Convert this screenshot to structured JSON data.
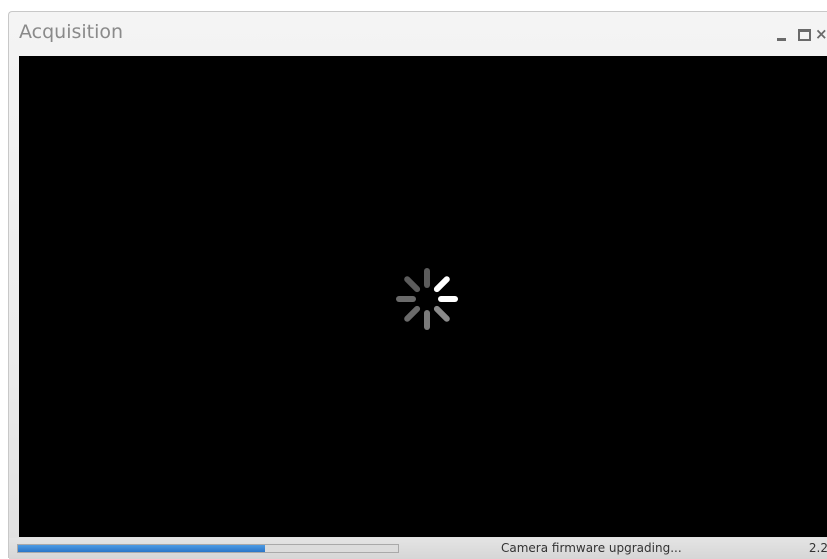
{
  "window": {
    "title": "Acquisition",
    "controls": [
      "minimize-icon",
      "maximize-icon",
      "close-icon"
    ],
    "close_glyph": "×"
  },
  "viewport": {
    "background": "#000000",
    "indicator": "loading-spinner-icon"
  },
  "status": {
    "progress_fraction": 0.65,
    "progress_color": "#2a76c8",
    "message": "Camera firmware upgrading...",
    "value": "2.2"
  }
}
